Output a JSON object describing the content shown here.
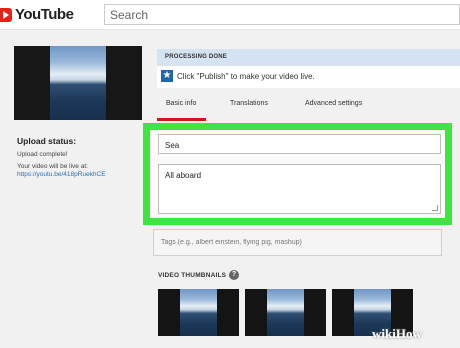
{
  "header": {
    "logo_text": "YouTube",
    "search_placeholder": "Search"
  },
  "left_panel": {
    "upload_status_title": "Upload status:",
    "upload_complete": "Upload complete!",
    "live_at_label": "Your video will be live at:",
    "video_link": "https://youtu.be/418pRuekhCE"
  },
  "processing": {
    "status": "PROCESSING DONE",
    "publish_message": "Click \"Publish\" to make your video live."
  },
  "tabs": [
    {
      "label": "Basic info",
      "active": true
    },
    {
      "label": "Translations",
      "active": false
    },
    {
      "label": "Advanced settings",
      "active": false
    }
  ],
  "form": {
    "title_value": "Sea",
    "description_value": "All aboard",
    "tags_placeholder": "Tags (e.g., albert einstein, flying pig, mashup)"
  },
  "thumbnails": {
    "label": "VIDEO THUMBNAILS",
    "count": 3
  },
  "watermark": {
    "prefix": "wiki",
    "suffix": "How"
  },
  "colors": {
    "youtube_red": "#e62117",
    "highlight_green": "#3de53d",
    "processing_bar": "#d5e3f3",
    "tab_underline": "#cc181e",
    "link_blue": "#2a6fba"
  }
}
